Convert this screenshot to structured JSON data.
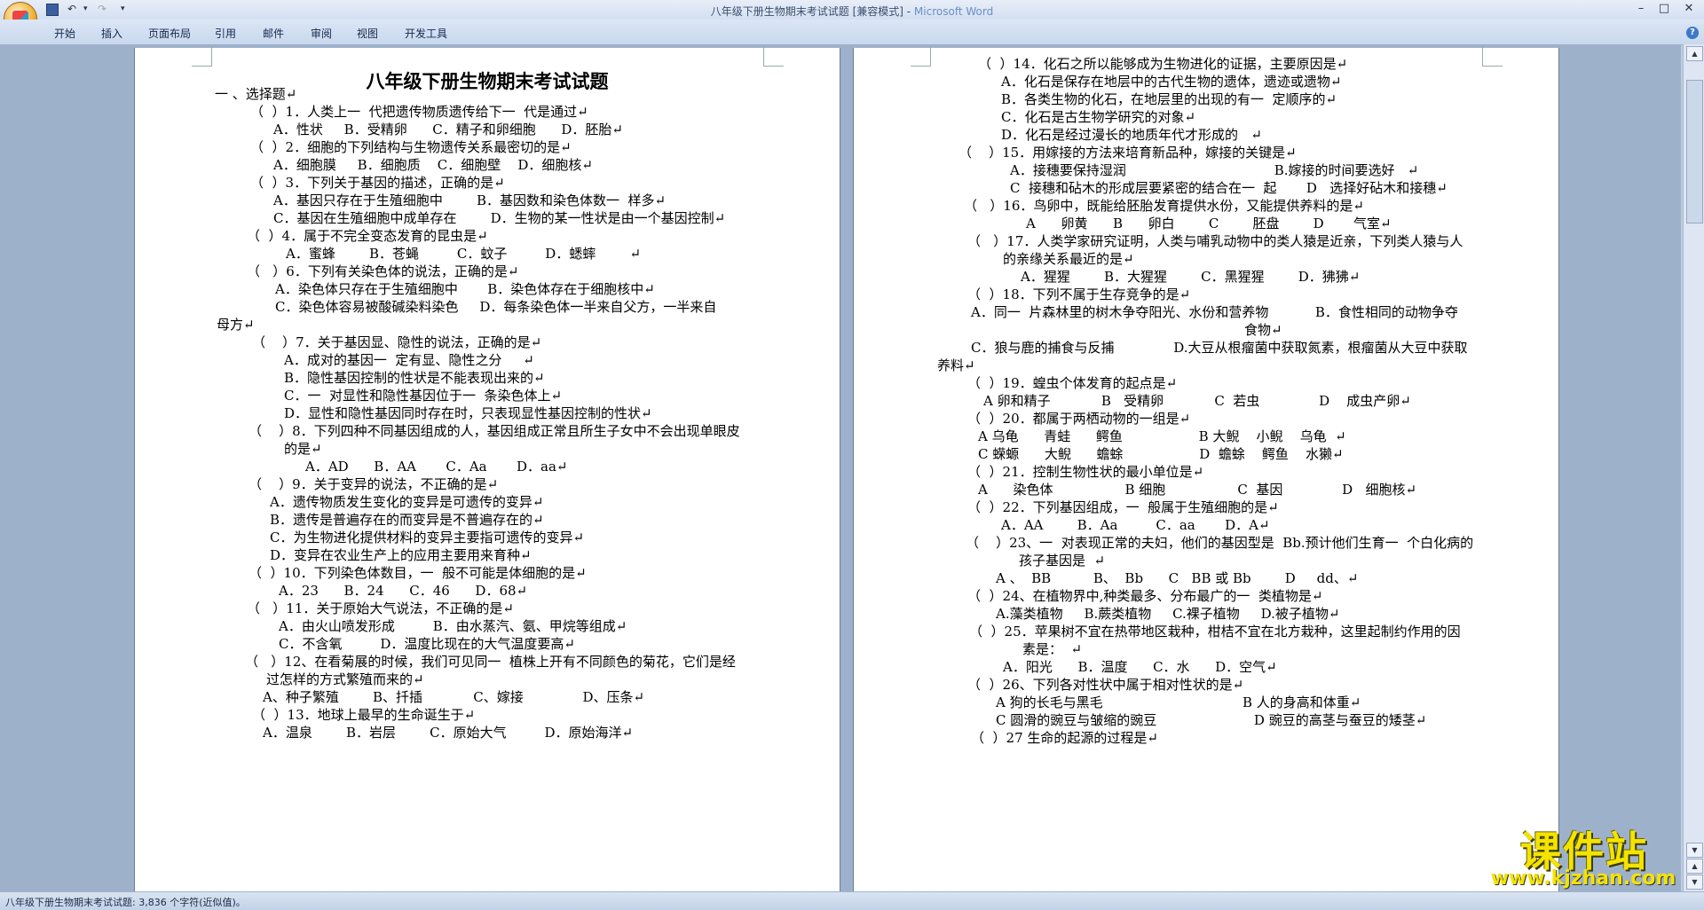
{
  "window": {
    "title_doc": "八年级下册生物期末考试试题 [兼容模式] - ",
    "title_app": "Microsoft Word"
  },
  "ribbon": {
    "tabs": [
      "开始",
      "插入",
      "页面布局",
      "引用",
      "邮件",
      "审阅",
      "视图",
      "开发工具"
    ]
  },
  "left_page": {
    "title": "八年级下册生物期末考试试题",
    "lines": [
      "一 、选择题↵",
      "（  ）1．人类上一  代把遗传物质遗传给下一  代是通过↵",
      "A．性状     B．受精卵      C．精子和卵细胞      D．胚胎↵",
      "（  ）2．细胞的下列结构与生物遗传关系最密切的是↵",
      "A．细胞膜     B．细胞质    C．细胞壁    D．细胞核↵",
      "（  ）3．下列关于基因的描述，正确的是↵",
      "A．基因只存在于生殖细胞中        B．基因数和染色体数一  样多↵",
      "C．基因在生殖细胞中成单存在        D．生物的某一性状是由一个基因控制↵",
      "（  ）4．属于不完全变态发育的昆虫是↵",
      "A．蜜蜂        B．苍蝇         C．蚊子         D．蟋蟀        ↵",
      "（   ）6．下列有关染色体的说法，正确的是↵",
      "A．染色体只存在于生殖细胞中       B．染色体存在于细胞核中↵",
      "C．染色体容易被酸碱染料染色     D．每条染色体一半来自父方，一半来自",
      "母方↵",
      "（    ）7．关于基因显、隐性的说法，正确的是↵",
      "A．成对的基因一  定有显、隐性之分     ↵",
      "B．隐性基因控制的性状是不能表现出来的↵",
      "C．一  对显性和隐性基因位于一  条染色体上↵",
      "D．显性和隐性基因同时存在时，只表现显性基因控制的性状↵",
      "（    ）8．下列四种不同基因组成的人，基因组成正常且所生子女中不会出现单眼皮",
      "的是↵",
      "A．AD      B．AA       C．Aa       D．aa↵",
      "（    ）9．关于变异的说法，不正确的是↵",
      "A．遗传物质发生变化的变异是可遗传的变异↵",
      "B．遗传是普遍存在的而变异是不普遍存在的↵",
      "C．为生物进化提供材料的变异主要指可遗传的变异↵",
      "D．变异在农业生产上的应用主要用来育种↵",
      "（  ）10．下列染色体数目，一  般不可能是体细胞的是↵",
      "A．23      B．24      C．46      D．68↵",
      "（   ）11．关于原始大气说法，不正确的是↵",
      "A．由火山喷发形成         B．由水蒸汽、氨、甲烷等组成↵",
      "C．不含氧         D．温度比现在的大气温度要高↵",
      "（   ）12、在看菊展的时候，我们可见同一  植株上开有不同颜色的菊花，它们是经",
      "过怎样的方式繁殖而来的↵",
      "A、种子繁殖        B、扦插            C、嫁接              D、压条↵",
      "（  ）13．地球上最早的生命诞生于↵",
      "A．温泉        B．岩层        C．原始大气         D．原始海洋↵"
    ]
  },
  "right_page": {
    "lines": [
      "（  ）14．化石之所以能够成为生物进化的证据，主要原因是↵",
      "A．化石是保存在地层中的古代生物的遗体，遗迹或遗物↵",
      "B．各类生物的化石，在地层里的出现的有一  定顺序的↵",
      "C．化石是古生物学研究的对象↵",
      "D．化石是经过漫长的地质年代才形成的   ↵",
      "（    ）15．用嫁接的方法来培育新品种，嫁接的关键是↵",
      "A．接穗要保持湿润                                   B.嫁接的时间要选好   ↵",
      "C  接穗和砧木的形成层要紧密的结合在一  起       D   选择好砧木和接穗↵",
      "（   ）16．鸟卵中，既能给胚胎发育提供水份，又能提供养料的是↵",
      "A      卵黄      B      卵白        C        胚盘        D       气室↵",
      "（   ）17．人类学家研究证明，人类与哺乳动物中的类人猿是近亲，下列类人猿与人",
      "的亲缘关系最近的是↵",
      "A．猩猩        B．大猩猩        C．黑猩猩        D．狒狒↵",
      "（  ）18．下列不属于生存竞争的是↵",
      "A．同一  片森林里的树木争夺阳光、水份和营养物           B．食性相同的动物争夺",
      "食物↵",
      "C．狼与鹿的捕食与反捕              D.大豆从根瘤菌中获取氮素，根瘤菌从大豆中获取",
      "养料↵",
      "（  ）19．蝗虫个体发育的起点是↵",
      "A 卵和精子            B   受精卵            C  若虫              D    成虫产卵↵",
      "（  ）20．都属于两栖动物的一组是↵",
      "A 乌龟      青蛙      鳄鱼                  B 大鲵    小鲵    乌龟  ↵",
      "C 蝾螈      大鲵      蟾蜍                  D  蟾蜍    鳄鱼    水獭↵",
      "（  ）21．控制生物性状的最小单位是↵",
      "A      染色体                 B 细胞                 C  基因              D   细胞核↵",
      "（  ）22．下列基因组成，一  般属于生殖细胞的是↵",
      "A．AA        B．Aa         C．aa       D．A↵",
      "（    ）23、一  对表现正常的夫妇，他们的基因型是  Bb.预计他们生育一  个白化病的",
      "孩子基因是  ↵",
      "A 、  BB          B、  Bb      C   BB 或 Bb        D     dd、↵",
      "（  ）24、在植物界中,种类最多、分布最广的一  类植物是↵",
      "A.藻类植物     B.蕨类植物     C.裸子植物     D.被子植物↵",
      "（  ）25．苹果树不宜在热带地区栽种，柑桔不宜在北方栽种，这里起制约作用的因",
      "素是：  ↵",
      "A．阳光      B．温度      C．水      D．空气↵",
      "（  ）26、下列各对性状中属于相对性状的是↵",
      "A 狗的长毛与黑毛                                 B 人的身高和体重↵",
      "C 圆滑的豌豆与皱缩的豌豆                       D 豌豆的高茎与蚕豆的矮茎↵",
      "（  ）27 生命的起源的过程是↵"
    ]
  },
  "status": {
    "text": "八年级下册生物期末考试试题: 3,836 个字符(近似值)。"
  },
  "watermark": {
    "name": "课件站",
    "url": "www.kjzhan.com"
  }
}
